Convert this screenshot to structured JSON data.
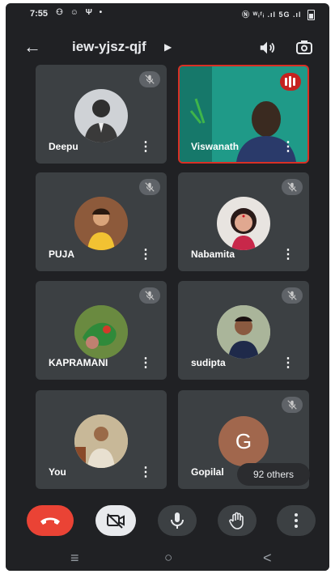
{
  "status_bar": {
    "time": "7:55",
    "left_icons": "⚇ ☺ Ψ •",
    "right_text": "Ⓝ ᵂᵢᶠᵢ .ıl 5G .ıl"
  },
  "header": {
    "meeting_code": "iew-yjsz-qjf"
  },
  "participants": [
    {
      "name": "Deepu",
      "muted": true
    },
    {
      "name": "Viswanath",
      "speaking": true
    },
    {
      "name": "PUJA",
      "muted": true
    },
    {
      "name": "Nabamita",
      "muted": true
    },
    {
      "name": "KAPRAMANI",
      "muted": true
    },
    {
      "name": "sudipta",
      "muted": true
    },
    {
      "name": "You",
      "muted": false
    },
    {
      "name": "Gopilal",
      "muted": true,
      "initial": "G"
    }
  ],
  "others_label": "92 others",
  "colors": {
    "background": "#202124",
    "tile": "#3c4043",
    "end_call": "#ea4335",
    "active_border": "#d93025",
    "initial_avatar": "#a1674d"
  }
}
